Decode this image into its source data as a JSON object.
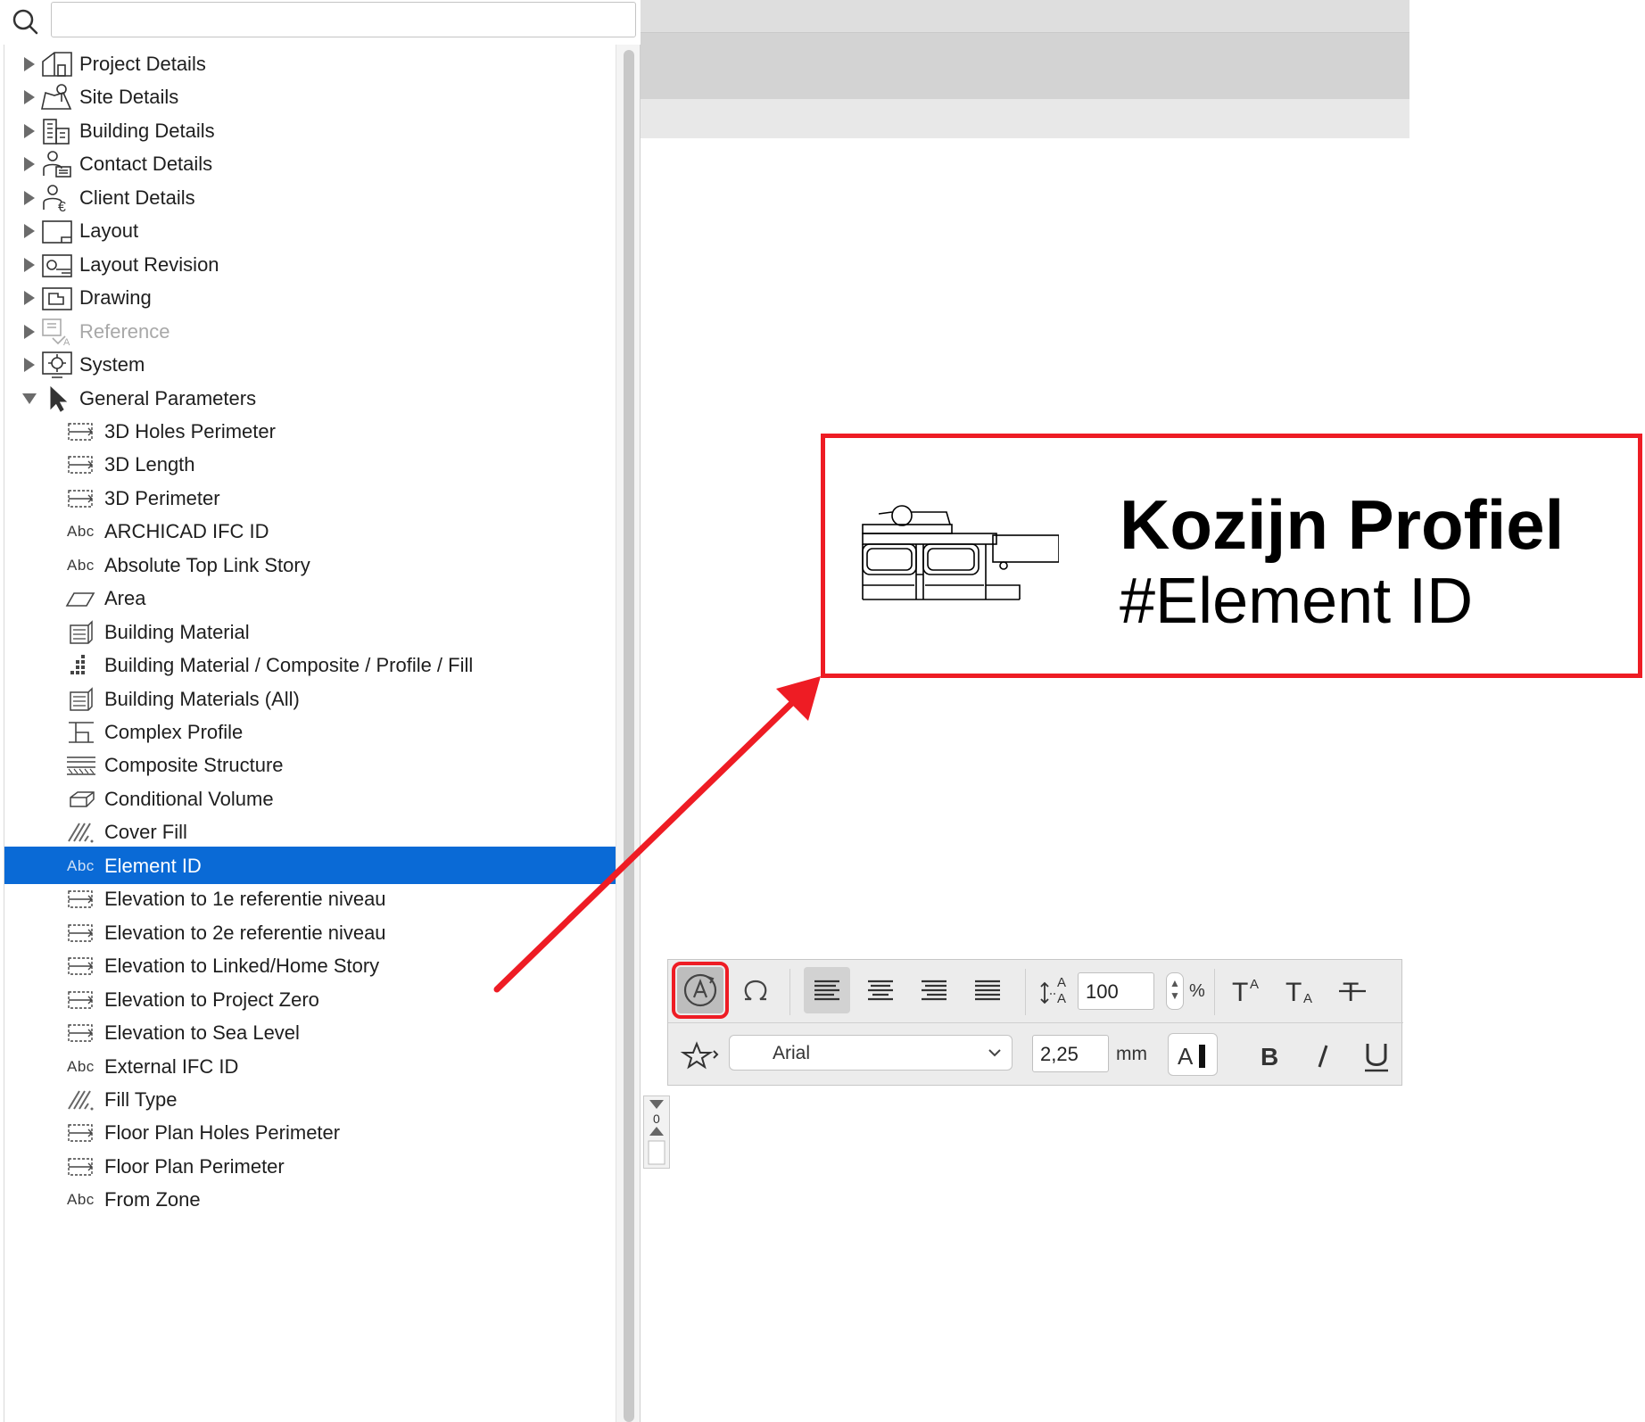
{
  "search": {
    "placeholder": "",
    "value": ""
  },
  "tree": {
    "top_items": [
      {
        "label": "Project Details",
        "icon": "project-details-icon",
        "expanded": false,
        "disabled": false
      },
      {
        "label": "Site Details",
        "icon": "site-details-icon",
        "expanded": false,
        "disabled": false
      },
      {
        "label": "Building Details",
        "icon": "building-details-icon",
        "expanded": false,
        "disabled": false
      },
      {
        "label": "Contact Details",
        "icon": "contact-details-icon",
        "expanded": false,
        "disabled": false
      },
      {
        "label": "Client Details",
        "icon": "client-details-icon",
        "expanded": false,
        "disabled": false
      },
      {
        "label": "Layout",
        "icon": "layout-icon",
        "expanded": false,
        "disabled": false
      },
      {
        "label": "Layout Revision",
        "icon": "layout-revision-icon",
        "expanded": false,
        "disabled": false
      },
      {
        "label": "Drawing",
        "icon": "drawing-icon",
        "expanded": false,
        "disabled": false
      },
      {
        "label": "Reference",
        "icon": "reference-icon",
        "expanded": false,
        "disabled": true
      },
      {
        "label": "System",
        "icon": "system-icon",
        "expanded": false,
        "disabled": false
      },
      {
        "label": "General Parameters",
        "icon": "cursor-arrow-icon",
        "expanded": true,
        "disabled": false
      }
    ],
    "general_parameters": [
      {
        "label": "3D Holes Perimeter",
        "icon": "dimension-icon",
        "selected": false
      },
      {
        "label": "3D Length",
        "icon": "dimension-icon",
        "selected": false
      },
      {
        "label": "3D Perimeter",
        "icon": "dimension-icon",
        "selected": false
      },
      {
        "label": "ARCHICAD IFC ID",
        "icon": "abc-text-icon",
        "selected": false
      },
      {
        "label": "Absolute Top Link Story",
        "icon": "abc-text-icon",
        "selected": false
      },
      {
        "label": "Area",
        "icon": "area-icon",
        "selected": false
      },
      {
        "label": "Building Material",
        "icon": "building-material-icon",
        "selected": false
      },
      {
        "label": "Building Material / Composite / Profile / Fill",
        "icon": "material-dots-icon",
        "selected": false
      },
      {
        "label": "Building Materials (All)",
        "icon": "building-material-icon",
        "selected": false
      },
      {
        "label": "Complex Profile",
        "icon": "complex-profile-icon",
        "selected": false
      },
      {
        "label": "Composite Structure",
        "icon": "composite-structure-icon",
        "selected": false
      },
      {
        "label": "Conditional Volume",
        "icon": "volume-icon",
        "selected": false
      },
      {
        "label": "Cover Fill",
        "icon": "hatch-fill-icon",
        "selected": false
      },
      {
        "label": "Element ID",
        "icon": "abc-text-icon",
        "selected": true
      },
      {
        "label": "Elevation to 1e referentie niveau",
        "icon": "dimension-icon",
        "selected": false
      },
      {
        "label": "Elevation to 2e referentie niveau",
        "icon": "dimension-icon",
        "selected": false
      },
      {
        "label": "Elevation to Linked/Home Story",
        "icon": "dimension-icon",
        "selected": false
      },
      {
        "label": "Elevation to Project Zero",
        "icon": "dimension-icon",
        "selected": false
      },
      {
        "label": "Elevation to Sea Level",
        "icon": "dimension-icon",
        "selected": false
      },
      {
        "label": "External IFC ID",
        "icon": "abc-text-icon",
        "selected": false
      },
      {
        "label": "Fill Type",
        "icon": "hatch-fill-icon",
        "selected": false
      },
      {
        "label": "Floor Plan Holes Perimeter",
        "icon": "dimension-icon",
        "selected": false
      },
      {
        "label": "Floor Plan Perimeter",
        "icon": "dimension-icon",
        "selected": false
      },
      {
        "label": "From Zone",
        "icon": "abc-text-icon",
        "selected": false
      }
    ],
    "abc_glyph": "Abc"
  },
  "label_preview": {
    "title": "Kozijn Profiel",
    "subtitle": "#Element ID",
    "border_color": "#ee1c24"
  },
  "toolbar": {
    "width_value": "100",
    "width_unit": "%",
    "font_name": "Arial",
    "font_size": "2,25",
    "size_unit": "mm",
    "pen_glyph": "A",
    "bold_glyph": "B",
    "italic_glyph": "/",
    "underline_glyph": "U"
  },
  "mini_widget": {
    "value": "0"
  },
  "colors": {
    "selection": "#0a6ad6",
    "highlight_red": "#ee1c24"
  }
}
